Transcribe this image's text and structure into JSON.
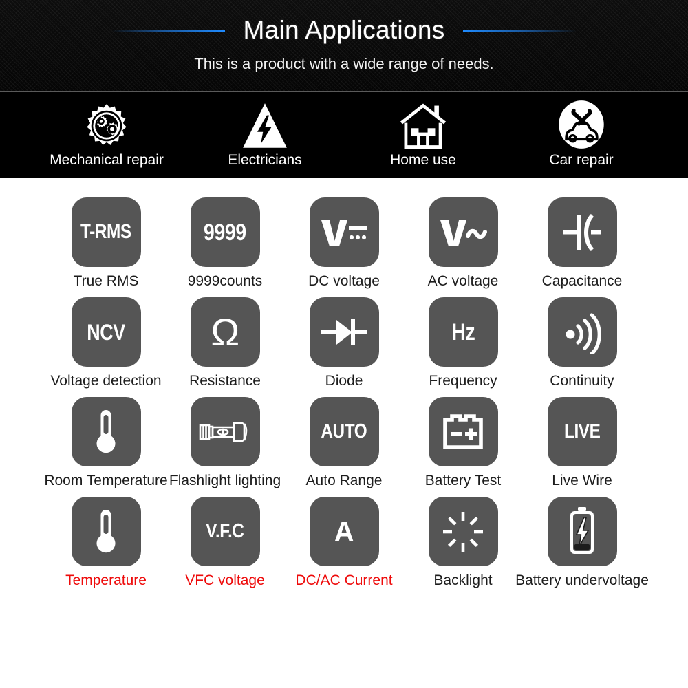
{
  "header": {
    "title": "Main Applications",
    "subtitle": "This is a product with a wide range of needs.",
    "accent_color": "#1f8bff",
    "background_color": "#0b0b0b"
  },
  "applications": [
    {
      "label": "Mechanical repair",
      "icon": "gear-icon"
    },
    {
      "label": "Electricians",
      "icon": "high-voltage-triangle-icon"
    },
    {
      "label": "Home use",
      "icon": "house-icon"
    },
    {
      "label": "Car repair",
      "icon": "car-repair-icon"
    }
  ],
  "features": {
    "tile_color": "#555555",
    "label_color": "#1d1d1d",
    "highlight_label_color": "#ee0b0b",
    "rows": [
      [
        {
          "symbol": "T-RMS",
          "icon": "t-rms-text-icon",
          "label": "True RMS",
          "highlight": false
        },
        {
          "symbol": "9999",
          "icon": "counts-text-icon",
          "label": "9999counts",
          "highlight": false
        },
        {
          "symbol": "V⎓",
          "icon": "dc-voltage-icon",
          "label": "DC voltage",
          "highlight": false
        },
        {
          "symbol": "V~",
          "icon": "ac-voltage-icon",
          "label": "AC voltage",
          "highlight": false
        },
        {
          "symbol": "⊣(",
          "icon": "capacitor-icon",
          "label": "Capacitance",
          "highlight": false
        }
      ],
      [
        {
          "symbol": "NCV",
          "icon": "ncv-text-icon",
          "label": "Voltage detection",
          "highlight": false
        },
        {
          "symbol": "Ω",
          "icon": "ohm-icon",
          "label": "Resistance",
          "highlight": false
        },
        {
          "symbol": "→|",
          "icon": "diode-icon",
          "label": "Diode",
          "highlight": false
        },
        {
          "symbol": "Hz",
          "icon": "hertz-text-icon",
          "label": "Frequency",
          "highlight": false
        },
        {
          "symbol": "))",
          "icon": "continuity-buzzer-icon",
          "label": "Continuity",
          "highlight": false
        }
      ],
      [
        {
          "symbol": "",
          "icon": "thermometer-icon",
          "label": "Room Temperature",
          "highlight": false
        },
        {
          "symbol": "",
          "icon": "flashlight-icon",
          "label": "Flashlight lighting",
          "highlight": false
        },
        {
          "symbol": "AUTO",
          "icon": "auto-text-icon",
          "label": "Auto Range",
          "highlight": false
        },
        {
          "symbol": "",
          "icon": "car-battery-icon",
          "label": "Battery Test",
          "highlight": false
        },
        {
          "symbol": "LIVE",
          "icon": "live-text-icon",
          "label": "Live Wire",
          "highlight": false
        }
      ],
      [
        {
          "symbol": "",
          "icon": "thermometer-icon",
          "label": "Temperature",
          "highlight": true
        },
        {
          "symbol": "V.F.C",
          "icon": "vfc-text-icon",
          "label": "VFC voltage",
          "highlight": true
        },
        {
          "symbol": "A",
          "icon": "ampere-text-icon",
          "label": "DC/AC Current",
          "highlight": true
        },
        {
          "symbol": "",
          "icon": "backlight-rays-icon",
          "label": "Backlight",
          "highlight": false
        },
        {
          "symbol": "",
          "icon": "battery-bolt-icon",
          "label": "Battery undervoltage",
          "highlight": false
        }
      ]
    ]
  }
}
